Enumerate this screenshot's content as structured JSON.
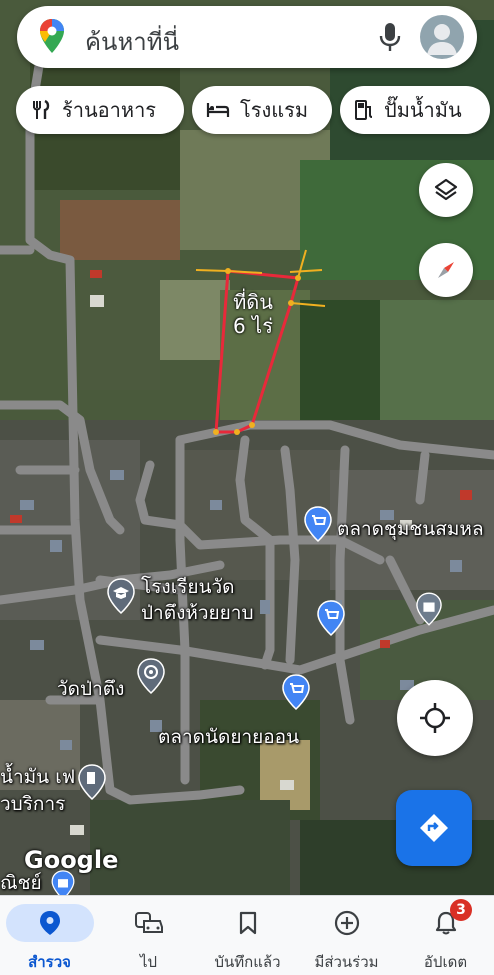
{
  "search": {
    "placeholder": "ค้นหาที่นี่"
  },
  "chips": [
    {
      "label": "ร้านอาหาร",
      "icon": "restaurant-icon"
    },
    {
      "label": "โรงแรม",
      "icon": "hotel-bed-icon"
    },
    {
      "label": "ปั๊มน้ำมัน",
      "icon": "gas-station-icon"
    }
  ],
  "annotation": {
    "line1": "ที่ดิน",
    "line2": "6 ไร่"
  },
  "places": {
    "market_chumchon": "ตลาดชุมชนสมหล",
    "school_line1": "โรงเรียนวัด",
    "school_line2": "ป่าตึงห้วยยาบ",
    "temple": "วัดป่าตึง",
    "market_nat": "ตลาดนัดยายออน",
    "gas_line1": "น้ำมัน เฟ",
    "gas_line2": "วบริการ",
    "bottom_left": "ณิชย์"
  },
  "watermark": "Google",
  "nav": [
    {
      "label": "สำรวจ",
      "icon": "explore-pin-icon",
      "active": true
    },
    {
      "label": "ไป",
      "icon": "commute-car-icon",
      "active": false
    },
    {
      "label": "บันทึกแล้ว",
      "icon": "bookmark-icon",
      "active": false
    },
    {
      "label": "มีส่วนร่วม",
      "icon": "add-circle-icon",
      "active": false
    },
    {
      "label": "อัปเดต",
      "icon": "bell-icon",
      "active": false,
      "badge": "3"
    }
  ],
  "colors": {
    "accent": "#1a73e8",
    "pin_blue": "#4285f4",
    "badge_red": "#d93025",
    "plot_outline": "#e8293a"
  }
}
